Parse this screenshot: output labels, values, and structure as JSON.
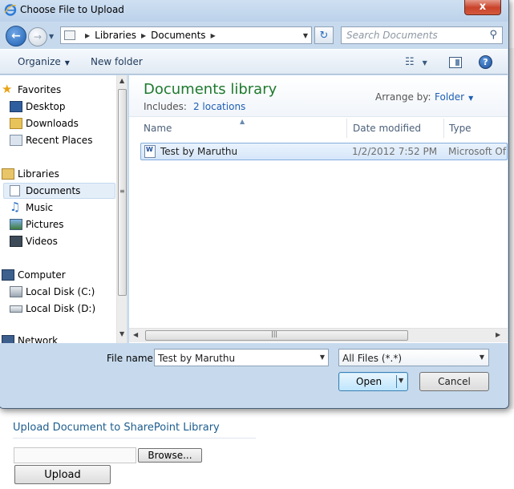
{
  "dialog": {
    "title": "Choose File to Upload",
    "close_glyph": "x"
  },
  "address": {
    "crumbs": [
      "Libraries",
      "Documents"
    ],
    "search_placeholder": "Search Documents"
  },
  "toolbar": {
    "organize": "Organize",
    "new_folder": "New folder"
  },
  "nav": {
    "favorites": "Favorites",
    "favorites_items": [
      "Desktop",
      "Downloads",
      "Recent Places"
    ],
    "libraries": "Libraries",
    "libraries_items": [
      "Documents",
      "Music",
      "Pictures",
      "Videos"
    ],
    "computer": "Computer",
    "computer_items": [
      "Local Disk (C:)",
      "Local Disk (D:)"
    ],
    "network_partial": "Network"
  },
  "main": {
    "library_title": "Documents library",
    "includes_label": "Includes:",
    "includes_link": "2 locations",
    "arrange_label": "Arrange by:",
    "arrange_value": "Folder",
    "columns": [
      "Name",
      "Date modified",
      "Type"
    ],
    "files": [
      {
        "name": "Test by Maruthu",
        "date": "1/2/2012 7:52 PM",
        "type": "Microsoft Of"
      }
    ]
  },
  "footer": {
    "file_name_label": "File name:",
    "file_name_value": "Test by Maruthu",
    "filter_value": "All Files (*.*)",
    "open_label": "Open",
    "cancel_label": "Cancel"
  },
  "page": {
    "heading": "Upload Document to SharePoint Library",
    "browse_label": "Browse...",
    "upload_label": "Upload"
  },
  "colors": {
    "library_title": "#1e7a2e",
    "link": "#1e5fb5",
    "sharepoint_heading": "#1d5d8f",
    "window_frame": "#c7daed"
  }
}
